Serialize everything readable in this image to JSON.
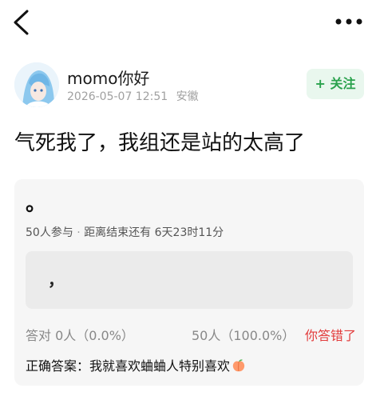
{
  "topbar": {
    "back_icon": "chevron-left-icon",
    "more_icon": "more-dots-icon"
  },
  "author": {
    "name": "momo你好",
    "timestamp": "2026-05-07 12:51",
    "location": "安徽",
    "follow_label": "+ 关注",
    "accent_color": "#2aa24d"
  },
  "post": {
    "title": "气死我了，我组还是站的太高了"
  },
  "quiz": {
    "question": "。",
    "participants": "50人参与",
    "separator": "·",
    "time_left": "距离结束还有 6天23时11分",
    "option_text": "，",
    "correct_stat": "答对  0人（0.0%）",
    "wrong_stat": "50人（100.0%）",
    "result_label": "你答错了",
    "result_color": "#e23b3b",
    "answer_text": "正确答案：我就喜欢蛐蛐人特别喜欢",
    "answer_emoji": "peach-icon"
  }
}
